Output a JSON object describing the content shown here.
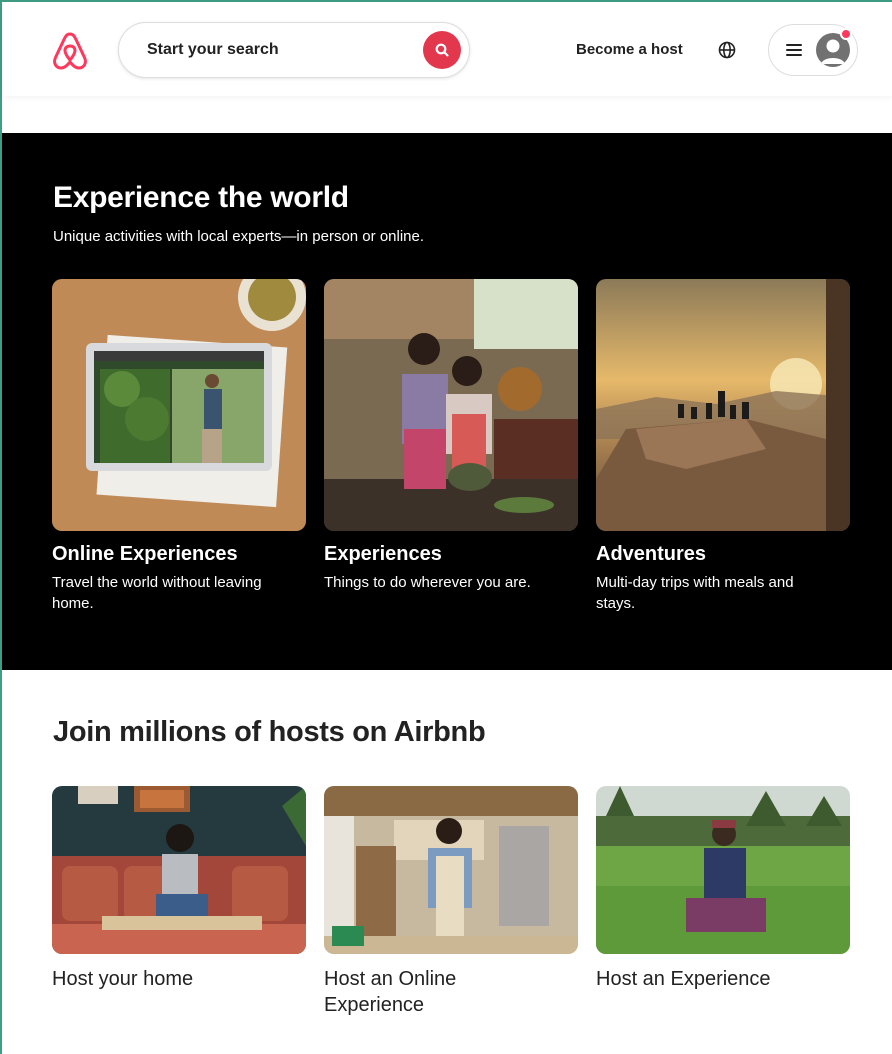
{
  "header": {
    "search_placeholder": "Start your search",
    "become_host": "Become a host",
    "icons": [
      "airbnb-logo",
      "search-icon",
      "globe-icon",
      "menu-icon",
      "user-avatar",
      "notification-dot"
    ]
  },
  "experiences": {
    "title": "Experience the world",
    "subtitle": "Unique activities with local experts—in person or online.",
    "cards": [
      {
        "title": "Online Experiences",
        "description": "Travel the world without leaving home."
      },
      {
        "title": "Experiences",
        "description": "Things to do wherever you are."
      },
      {
        "title": "Adventures",
        "description": "Multi-day trips with meals and stays."
      }
    ]
  },
  "hosts": {
    "title": "Join millions of hosts on Airbnb",
    "cards": [
      {
        "title": "Host your home"
      },
      {
        "title": "Host an Online Experience"
      },
      {
        "title": "Host an Experience"
      }
    ]
  },
  "colors": {
    "brand": "#ff385c",
    "search_button": "#e3374e",
    "section_dark": "#000000"
  }
}
